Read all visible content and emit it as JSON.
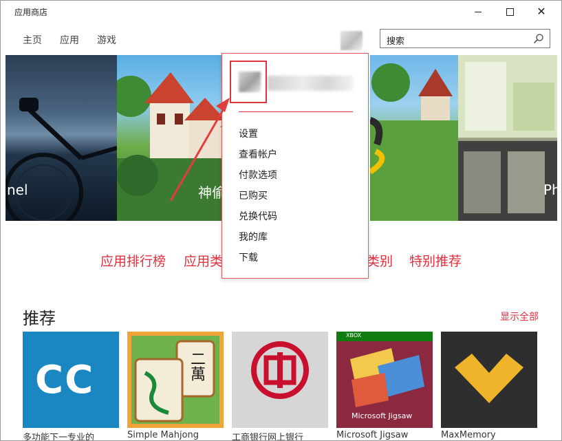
{
  "window": {
    "title": "应用商店",
    "minimize_icon": "minimize-icon",
    "maximize_icon": "maximize-icon",
    "close_icon": "close-icon"
  },
  "nav": {
    "items": [
      {
        "label": "主页"
      },
      {
        "label": "应用"
      },
      {
        "label": "游戏"
      }
    ]
  },
  "search": {
    "placeholder": "搜索",
    "icon": "search-icon"
  },
  "hero": {
    "captions": [
      "nel",
      "神偷",
      "Ph"
    ]
  },
  "categories": {
    "links": [
      "应用排行榜",
      "应用类",
      "类别",
      "特别推荐"
    ]
  },
  "recommended": {
    "title": "推荐",
    "show_all": "显示全部",
    "tiles": [
      {
        "art_text": "CC",
        "caption": "多功能下一专业的",
        "color": "#1b87c2"
      },
      {
        "art_text": "二萬",
        "caption": "Simple Mahjong",
        "color": "#e58d2a"
      },
      {
        "art_text": "",
        "caption": "工商银行网上银行",
        "color": "#d6d6d6"
      },
      {
        "art_text": "Microsoft Jigsaw",
        "badge": "XBOX",
        "caption": "Microsoft Jigsaw",
        "color": "#8a2940"
      },
      {
        "art_text": "",
        "caption": "MaxMemory",
        "color": "#2e2e2e"
      }
    ]
  },
  "account_menu": {
    "items": [
      "设置",
      "查看帐户",
      "付款选项",
      "已购买",
      "兑换代码",
      "我的库",
      "下载"
    ],
    "accent": "#e0303d"
  }
}
